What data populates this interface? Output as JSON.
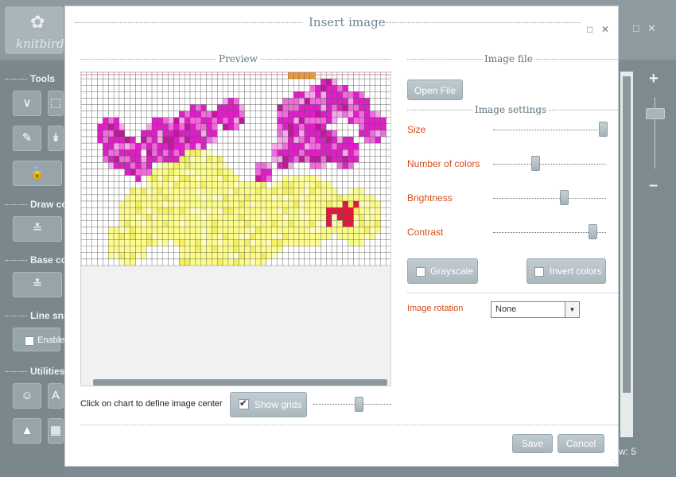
{
  "app": {
    "logo_text": "knitbird",
    "sidebar": {
      "tools": "Tools",
      "draw_color": "Draw colo",
      "base_color": "Base colo",
      "line_snap": "Line snap",
      "enable": "Enable",
      "utilities": "Utilities"
    },
    "status": "w: 5"
  },
  "dialog": {
    "title": "Insert image",
    "preview_title": "Preview",
    "image_file_title": "Image file",
    "open_file": "Open File",
    "image_settings_title": "Image settings",
    "sliders": [
      {
        "label": "Size",
        "value": 0.97
      },
      {
        "label": "Number of colors",
        "value": 0.37
      },
      {
        "label": "Brightness",
        "value": 0.63
      },
      {
        "label": "Contrast",
        "value": 0.88
      }
    ],
    "grayscale": {
      "label": "Grayscale",
      "checked": false
    },
    "invert": {
      "label": "Invert colors",
      "checked": false
    },
    "rotation": {
      "label": "Image rotation",
      "value": "None"
    },
    "hint": "Click on chart to define image center",
    "show_grids": {
      "label": "Show grids",
      "checked": true
    },
    "grid_slider_value": 0.58,
    "save": "Save",
    "cancel": "Cancel",
    "colors": {
      "accent_label": "#d84a1b",
      "magenta": "#e01ec8",
      "pink": "#f06cdc",
      "yellow": "#fcfc8a",
      "red": "#e8143c"
    }
  }
}
